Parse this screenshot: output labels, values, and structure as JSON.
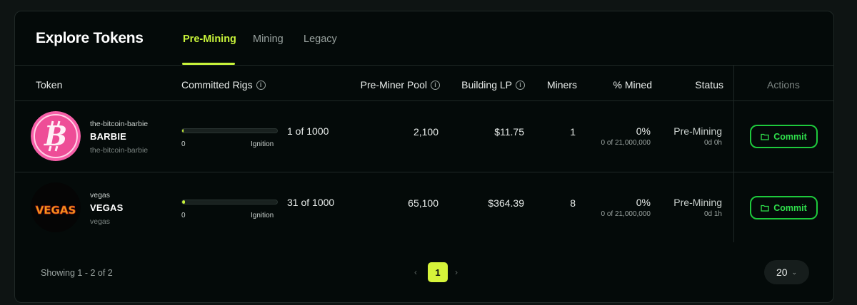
{
  "header": {
    "title": "Explore Tokens",
    "tabs": [
      {
        "label": "Pre-Mining",
        "active": true
      },
      {
        "label": "Mining",
        "active": false
      },
      {
        "label": "Legacy",
        "active": false
      }
    ]
  },
  "table": {
    "columns": {
      "token": "Token",
      "committed_rigs": "Committed Rigs",
      "pre_miner_pool": "Pre-Miner Pool",
      "building_lp": "Building LP",
      "miners": "Miners",
      "pct_mined": "% Mined",
      "status": "Status",
      "actions": "Actions"
    },
    "rows": [
      {
        "sub_top": "the-bitcoin-barbie",
        "name": "BARBIE",
        "sub_bot": "the-bitcoin-barbie",
        "avatar_icon": "barbie-bitcoin-logo",
        "rigs_progress": 0.001,
        "rigs_min": "0",
        "rigs_max": "Ignition",
        "rigs_count": "1 of 1000",
        "pool": "2,100",
        "lp": "$11.75",
        "miners": "1",
        "mined_pct": "0%",
        "mined_sub": "0 of 21,000,000",
        "status": "Pre-Mining",
        "status_sub": "0d 0h",
        "action": "Commit"
      },
      {
        "sub_top": "vegas",
        "name": "VEGAS",
        "sub_bot": "vegas",
        "avatar_icon": "vegas-logo",
        "avatar_text": "VEGAS",
        "rigs_progress": 0.031,
        "rigs_min": "0",
        "rigs_max": "Ignition",
        "rigs_count": "31 of 1000",
        "pool": "65,100",
        "lp": "$364.39",
        "miners": "8",
        "mined_pct": "0%",
        "mined_sub": "0 of 21,000,000",
        "status": "Pre-Mining",
        "status_sub": "0d 1h",
        "action": "Commit"
      }
    ]
  },
  "footer": {
    "showing": "Showing 1 - 2 of 2",
    "current_page": "1",
    "prev": "‹",
    "next": "›",
    "page_size": "20"
  },
  "colors": {
    "accent": "#c8f33a",
    "commit": "#1ec93c",
    "background": "#040a09"
  }
}
